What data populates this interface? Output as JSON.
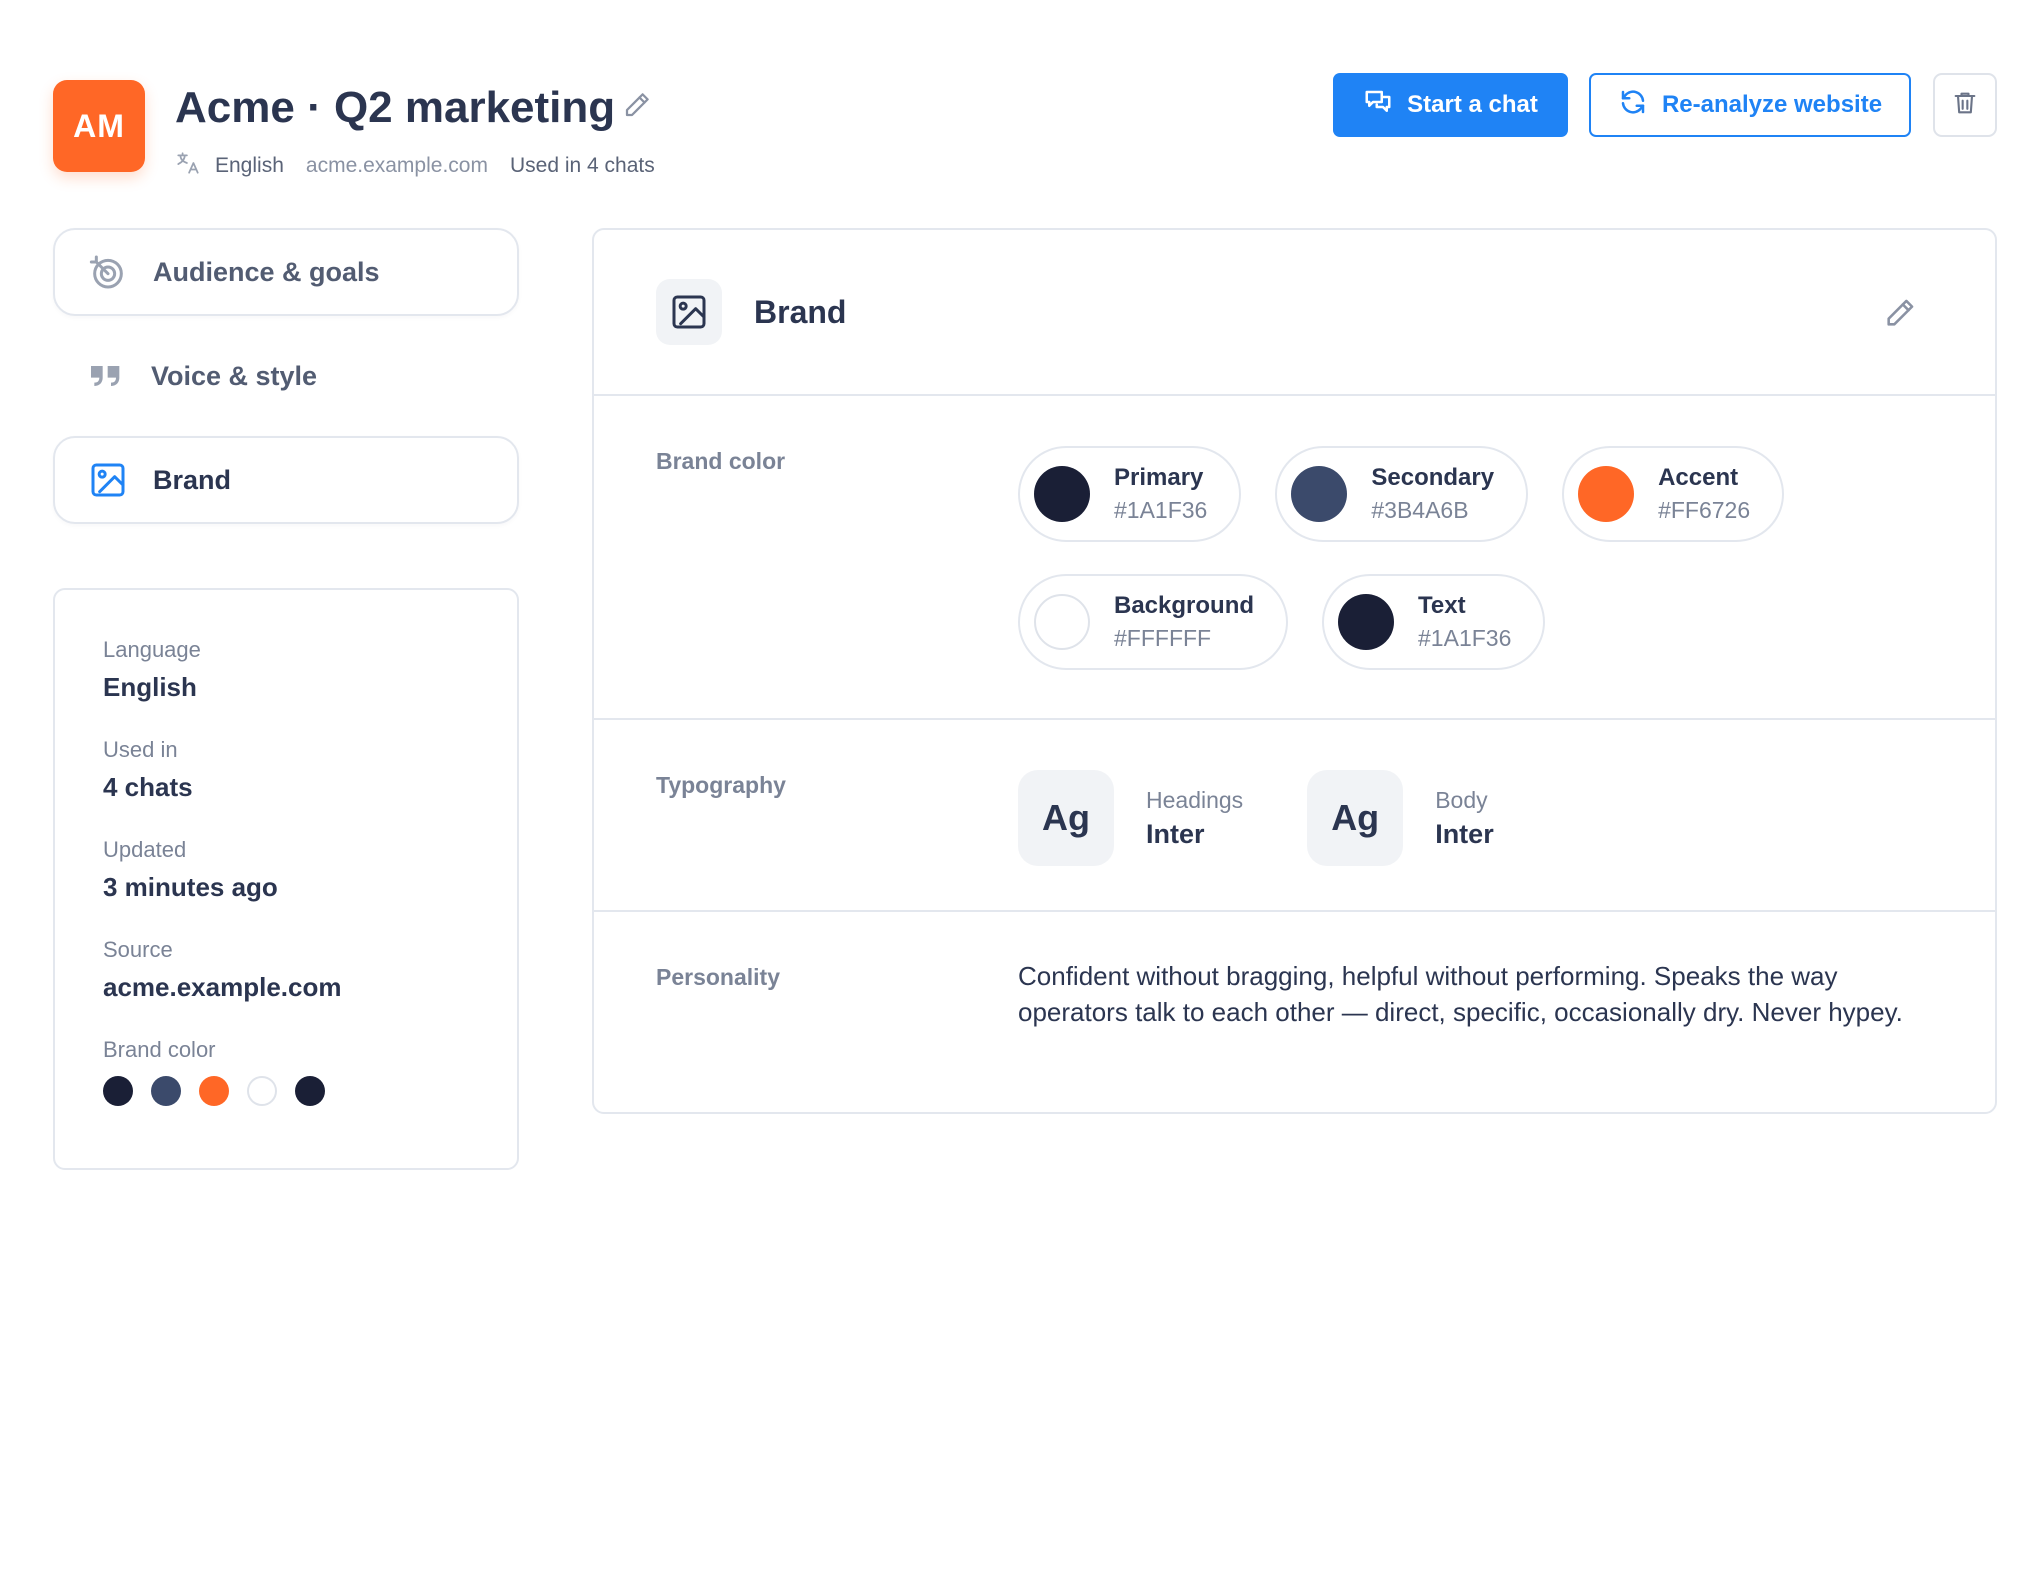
{
  "header": {
    "avatar_initials": "AM",
    "title": "Acme · Q2 marketing",
    "language": "English",
    "domain": "acme.example.com",
    "usage": "Used in 4 chats",
    "start_chat_label": "Start a chat",
    "reanalyze_label": "Re-analyze website"
  },
  "sidebar": {
    "items": [
      {
        "label": "Audience & goals",
        "icon": "target-icon"
      },
      {
        "label": "Voice & style",
        "icon": "quote-icon"
      },
      {
        "label": "Brand",
        "icon": "image-icon"
      }
    ],
    "active": "Brand"
  },
  "info": {
    "language_label": "Language",
    "language_value": "English",
    "used_label": "Used in",
    "used_value": "4 chats",
    "updated_label": "Updated",
    "updated_value": "3 minutes ago",
    "source_label": "Source",
    "source_value": "acme.example.com",
    "brand_color_label": "Brand color"
  },
  "panel": {
    "title": "Brand",
    "brand_color": {
      "label": "Brand color",
      "colors": [
        {
          "name": "Primary",
          "hex": "#1A1F36"
        },
        {
          "name": "Secondary",
          "hex": "#3B4A6B"
        },
        {
          "name": "Accent",
          "hex": "#FF6726"
        },
        {
          "name": "Background",
          "hex": "#FFFFFF"
        },
        {
          "name": "Text",
          "hex": "#1A1F36"
        }
      ]
    },
    "typography": {
      "label": "Typography",
      "sample": "Ag",
      "headings_label": "Headings",
      "headings_font": "Inter",
      "body_label": "Body",
      "body_font": "Inter"
    },
    "personality": {
      "label": "Personality",
      "text": "Confident without bragging, helpful without performing. Speaks the way operators talk to each other — direct, specific, occasionally dry. Never hypey."
    }
  },
  "colors": {
    "accent": "#1F83F5",
    "avatar": "#FF6726"
  }
}
